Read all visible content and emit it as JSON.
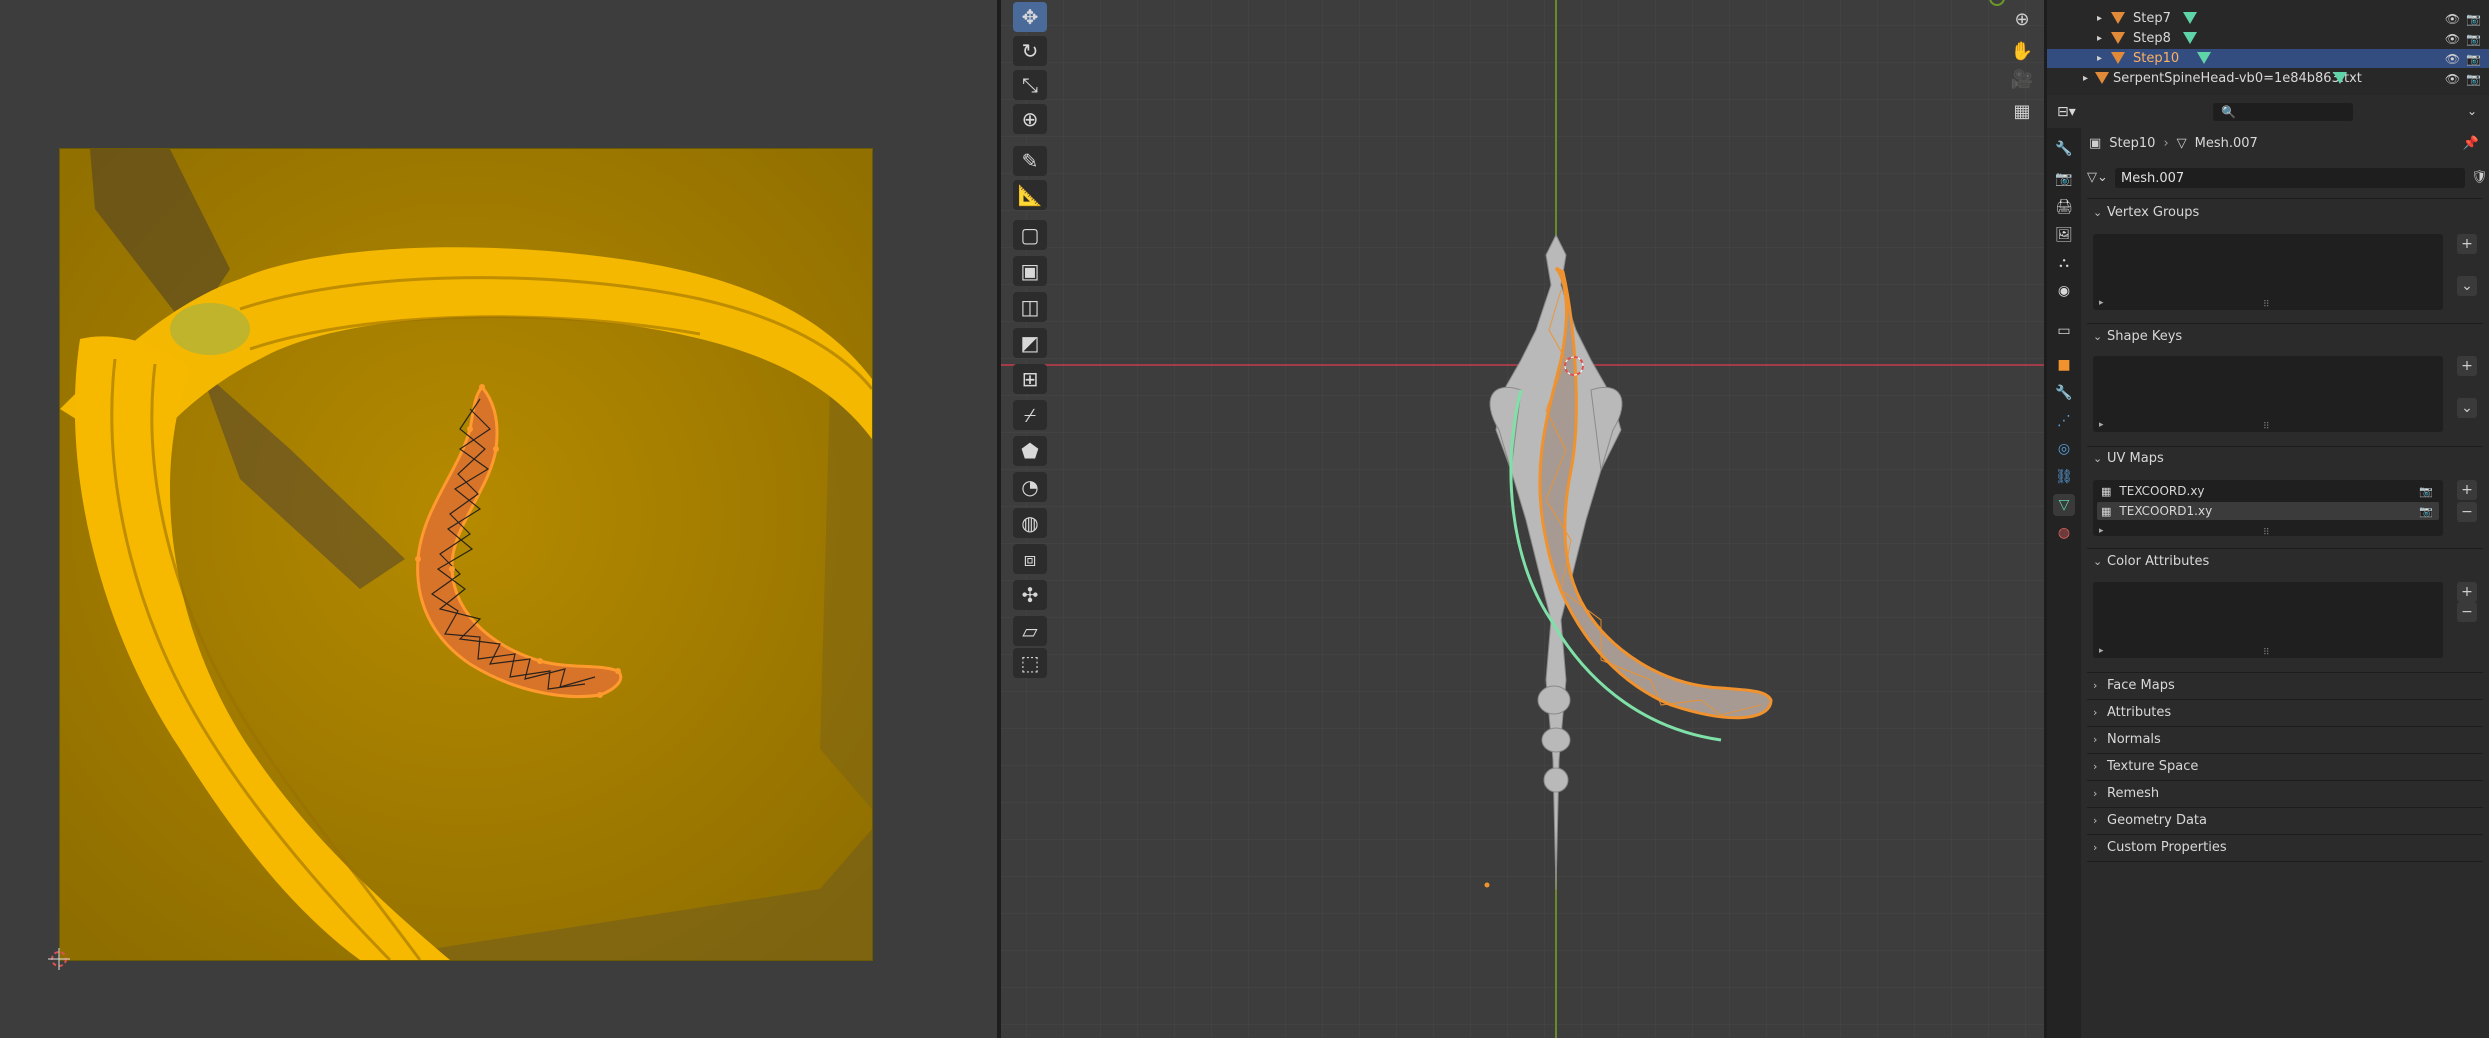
{
  "outliner": {
    "rows": [
      {
        "name": "Step7"
      },
      {
        "name": "Step8"
      },
      {
        "name": "Step10",
        "selected": true
      },
      {
        "name": "SerpentSpineHead-vb0=1e84b863.txt"
      }
    ]
  },
  "properties": {
    "breadcrumb": {
      "object": "Step10",
      "data": "Mesh.007"
    },
    "mesh_name": "Mesh.007",
    "panels": {
      "vertex_groups": "Vertex Groups",
      "shape_keys": "Shape Keys",
      "uv_maps": "UV Maps",
      "color_attributes": "Color Attributes"
    },
    "uv_maps": [
      "TEXCOORD.xy",
      "TEXCOORD1.xy"
    ],
    "collapsed_sections": [
      "Face Maps",
      "Attributes",
      "Normals",
      "Texture Space",
      "Remesh",
      "Geometry Data",
      "Custom Properties"
    ]
  },
  "colors": {
    "selection_orange": "#f0922e",
    "uv_backdrop": "#a88200",
    "outline_green": "#7fe0a8",
    "selected_row": "#334d80"
  },
  "icons": {
    "toolbar": [
      "move-icon",
      "rotate-icon",
      "scale-icon",
      "transform-icon",
      "annotate-icon",
      "measure-icon",
      "add-cube-icon",
      "extrude-icon",
      "inset-icon",
      "bevel-icon",
      "loop-cut-icon",
      "knife-icon",
      "poly-build-icon",
      "spin-icon",
      "smooth-icon",
      "edge-slide-icon",
      "shrink-fatten-icon",
      "shear-icon",
      "rip-region-icon"
    ]
  }
}
